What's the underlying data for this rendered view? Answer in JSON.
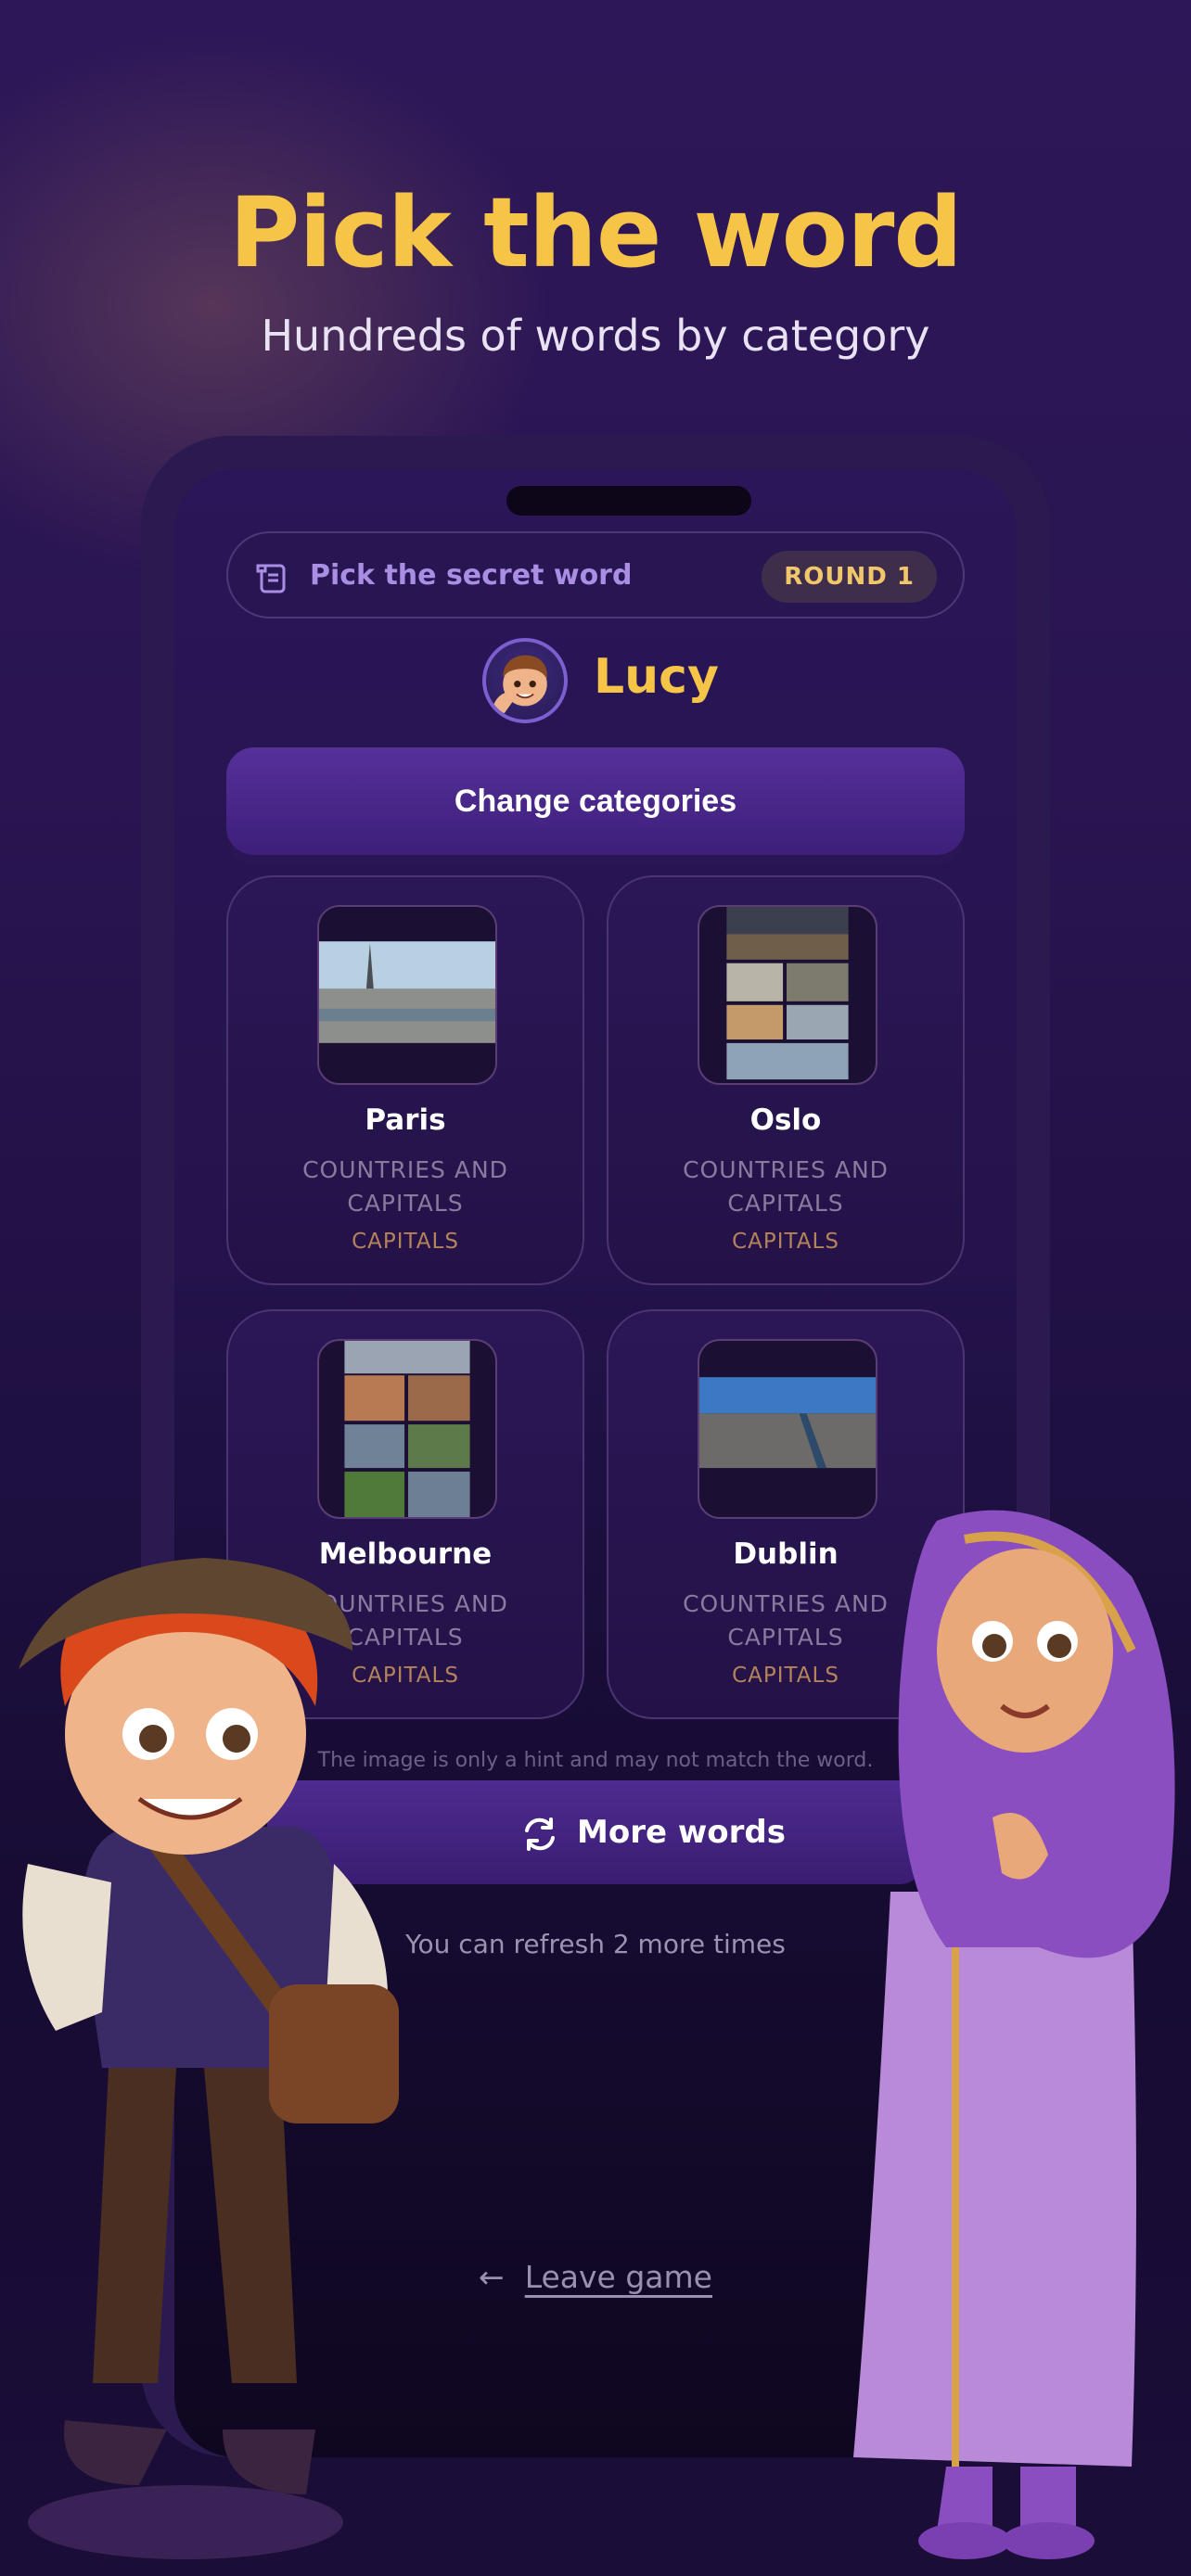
{
  "header": {
    "title": "Pick the word",
    "subtitle": "Hundreds of words by category"
  },
  "game": {
    "topbar_title": "Pick the secret word",
    "round_label": "ROUND 1",
    "player_name": "Lucy",
    "change_categories": "Change categories",
    "cards": [
      {
        "name": "Paris",
        "category": "COUNTRIES AND CAPITALS",
        "subcategory": "CAPITALS"
      },
      {
        "name": "Oslo",
        "category": "COUNTRIES AND CAPITALS",
        "subcategory": "CAPITALS"
      },
      {
        "name": "Melbourne",
        "category": "COUNTRIES AND CAPITALS",
        "subcategory": "CAPITALS"
      },
      {
        "name": "Dublin",
        "category": "COUNTRIES AND CAPITALS",
        "subcategory": "CAPITALS"
      }
    ],
    "hint_text": "The image is only a hint and may not match the word.",
    "more_words": "More words",
    "refresh_text": "You can refresh 2 more times",
    "leave_game": "Leave game"
  },
  "icons": {
    "topbar": "scroll-icon",
    "more": "refresh-icon",
    "leave": "arrow-left-icon"
  },
  "colors": {
    "accent": "#f6c548",
    "button": "#4e2b90",
    "background": "#2a1552"
  }
}
